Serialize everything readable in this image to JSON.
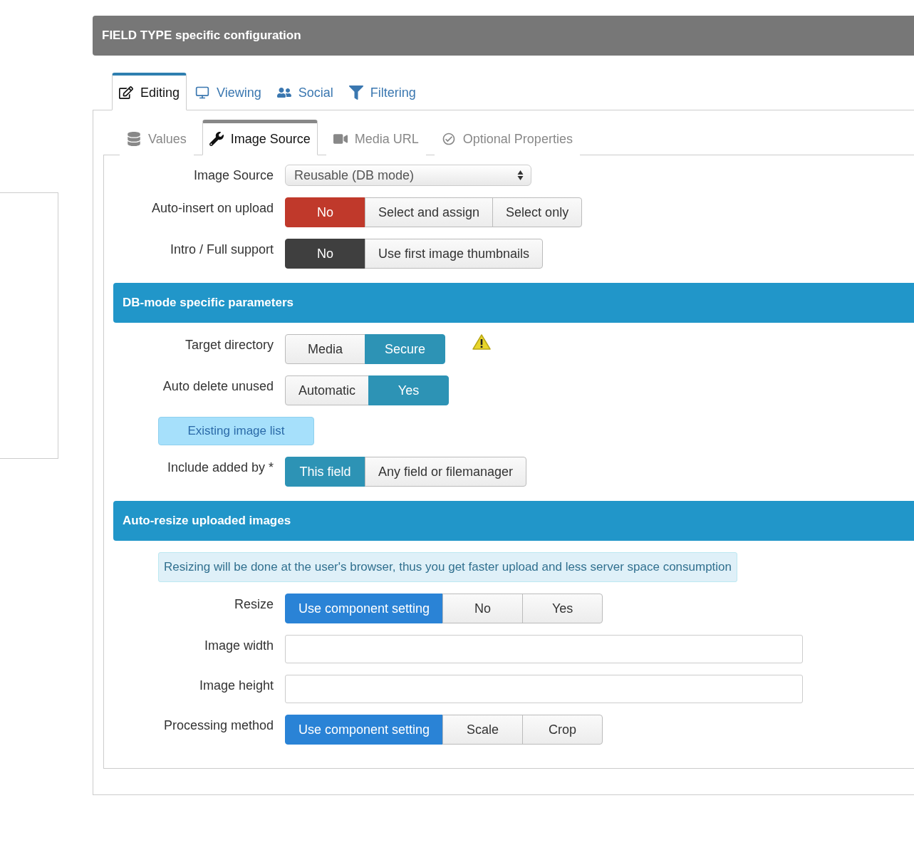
{
  "panel_title": "FIELD TYPE specific configuration",
  "tabs": [
    {
      "label": "Editing",
      "selected": true
    },
    {
      "label": "Viewing",
      "selected": false
    },
    {
      "label": "Social",
      "selected": false
    },
    {
      "label": "Filtering",
      "selected": false
    }
  ],
  "subtabs": [
    {
      "label": "Values",
      "selected": false
    },
    {
      "label": "Image Source",
      "selected": true
    },
    {
      "label": "Media URL",
      "selected": false
    },
    {
      "label": "Optional Properties",
      "selected": false
    }
  ],
  "sections": [
    {
      "rows": [
        {
          "kind": "select",
          "label": "Image Source",
          "value": "Reusable (DB mode)"
        },
        {
          "kind": "toggle",
          "label": "Auto-insert on upload",
          "options": [
            {
              "label": "No",
              "selected": true,
              "color": "#c0392b"
            },
            {
              "label": "Select and assign",
              "selected": false
            },
            {
              "label": "Select only",
              "selected": false
            }
          ]
        },
        {
          "kind": "toggle",
          "label": "Intro / Full support",
          "options": [
            {
              "label": "No",
              "selected": true,
              "color": "#3f3f3f"
            },
            {
              "label": "Use first image thumbnails",
              "selected": false
            }
          ]
        }
      ]
    },
    {
      "heading": "DB-mode specific parameters",
      "rows": [
        {
          "kind": "toggle",
          "label": "Target directory",
          "warning": true,
          "options": [
            {
              "label": "Media",
              "selected": false
            },
            {
              "label": "Secure",
              "selected": true,
              "color": "#2d93b5"
            }
          ]
        },
        {
          "kind": "toggle",
          "label": "Auto delete unused",
          "options": [
            {
              "label": "Automatic",
              "selected": false
            },
            {
              "label": "Yes",
              "selected": true,
              "color": "#2d93b5"
            }
          ]
        },
        {
          "kind": "action",
          "label": "Existing image list"
        },
        {
          "kind": "toggle",
          "label": "Include added by *",
          "options": [
            {
              "label": "This field",
              "selected": true,
              "color": "#2d93b5"
            },
            {
              "label": "Any field or filemanager",
              "selected": false
            }
          ]
        }
      ]
    },
    {
      "heading": "Auto-resize uploaded images",
      "rows": [
        {
          "kind": "note",
          "text": "Resizing will be done at the user's browser, thus you get faster upload and less server space consumption"
        },
        {
          "kind": "toggle",
          "label": "Resize",
          "options": [
            {
              "label": "Use component setting",
              "selected": true,
              "color": "#2a83d6"
            },
            {
              "label": "No",
              "selected": false
            },
            {
              "label": "Yes",
              "selected": false
            }
          ]
        },
        {
          "kind": "input",
          "label": "Image width"
        },
        {
          "kind": "input",
          "label": "Image height"
        },
        {
          "kind": "toggle",
          "label": "Processing method",
          "options": [
            {
              "label": "Use component setting",
              "selected": true,
              "color": "#2a83d6"
            },
            {
              "label": "Scale",
              "selected": false
            },
            {
              "label": "Crop",
              "selected": false
            }
          ]
        }
      ]
    }
  ]
}
